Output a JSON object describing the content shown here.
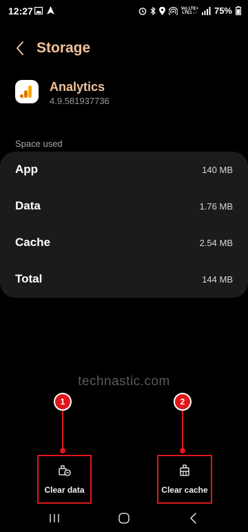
{
  "status_bar": {
    "time": "12:27",
    "network_top": "Vo) LTE+",
    "network_bottom": "LTE1 ↓↑",
    "battery": "75%"
  },
  "header": {
    "title": "Storage"
  },
  "app": {
    "name": "Analytics",
    "version": "4.9.581937736"
  },
  "storage": {
    "section_label": "Space used",
    "rows": [
      {
        "label": "App",
        "value": "140 MB"
      },
      {
        "label": "Data",
        "value": "1.76 MB"
      },
      {
        "label": "Cache",
        "value": "2.54 MB"
      },
      {
        "label": "Total",
        "value": "144 MB"
      }
    ]
  },
  "watermark": "technastic.com",
  "annotations": {
    "marker_1": "1",
    "marker_2": "2"
  },
  "actions": {
    "clear_data": "Clear data",
    "clear_cache": "Clear cache"
  },
  "colors": {
    "accent": "#f2c29b",
    "annotation_red": "#e0161b",
    "card_bg": "#1b1b1b"
  }
}
